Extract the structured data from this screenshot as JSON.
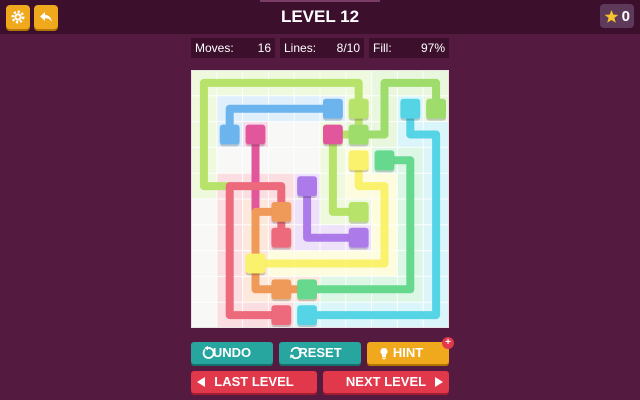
{
  "header": {
    "title": "LEVEL 12",
    "stars_count": "0"
  },
  "stats": {
    "moves_label": "Moves:",
    "moves_value": "16",
    "lines_label": "Lines:",
    "lines_value": "8/10",
    "fill_label": "Fill:",
    "fill_value": "97%"
  },
  "buttons": {
    "undo": "UNDO",
    "reset": "RESET",
    "hint": "HINT",
    "hint_badge": "+",
    "last_level": "LAST LEVEL",
    "next_level": "NEXT LEVEL"
  },
  "icons": {
    "settings": "gear-icon",
    "back": "reply-arrow-icon",
    "star": "star-icon",
    "undo": "undo-icon",
    "reset": "refresh-icon",
    "hint": "lightbulb-icon"
  },
  "board": {
    "grid_size": 10,
    "colors": {
      "lime": "#b8e36a",
      "blue": "#6cb4ee",
      "pink": "#e2579c",
      "green": "#66d98e",
      "cyan": "#55d4e6",
      "yellow": "#faf26c",
      "purple": "#ad7ae9",
      "orange": "#f09a5a",
      "red": "#ec6a7b",
      "lightgreen": "#9edc6c"
    },
    "flows": [
      {
        "color": "lime",
        "cells": [
          [
            1,
            4
          ],
          [
            0,
            4
          ],
          [
            0,
            3
          ],
          [
            0,
            2
          ],
          [
            0,
            1
          ],
          [
            0,
            0
          ],
          [
            1,
            0
          ],
          [
            2,
            0
          ],
          [
            3,
            0
          ],
          [
            4,
            0
          ],
          [
            5,
            0
          ],
          [
            6,
            0
          ],
          [
            6,
            1
          ],
          [
            6,
            2
          ],
          [
            5,
            2
          ],
          [
            5,
            3
          ],
          [
            5,
            4
          ],
          [
            5,
            5
          ],
          [
            6,
            5
          ]
        ]
      },
      {
        "color": "blue",
        "cells": [
          [
            1,
            2
          ],
          [
            1,
            1
          ],
          [
            2,
            1
          ],
          [
            3,
            1
          ],
          [
            4,
            1
          ],
          [
            5,
            1
          ]
        ]
      },
      {
        "color": "pink",
        "cells": [
          [
            2,
            2
          ],
          [
            2,
            5
          ]
        ]
      },
      {
        "color": "lightgreen",
        "cells": [
          [
            9,
            1
          ],
          [
            9,
            0
          ],
          [
            8,
            0
          ],
          [
            7,
            0
          ],
          [
            7,
            1
          ],
          [
            7,
            2
          ],
          [
            6,
            2
          ]
        ]
      },
      {
        "color": "cyan",
        "cells": [
          [
            8,
            1
          ],
          [
            8,
            2
          ],
          [
            9,
            2
          ],
          [
            9,
            3
          ],
          [
            9,
            4
          ],
          [
            9,
            5
          ],
          [
            9,
            6
          ],
          [
            9,
            7
          ],
          [
            9,
            8
          ],
          [
            9,
            9
          ],
          [
            8,
            9
          ],
          [
            7,
            9
          ],
          [
            6,
            9
          ],
          [
            5,
            9
          ],
          [
            4,
            9
          ]
        ]
      },
      {
        "color": "green",
        "cells": [
          [
            7,
            3
          ],
          [
            8,
            3
          ],
          [
            8,
            4
          ],
          [
            8,
            5
          ],
          [
            8,
            6
          ],
          [
            8,
            7
          ],
          [
            8,
            8
          ],
          [
            7,
            8
          ],
          [
            6,
            8
          ],
          [
            5,
            8
          ],
          [
            4,
            8
          ]
        ]
      },
      {
        "color": "yellow",
        "cells": [
          [
            6,
            3
          ],
          [
            6,
            4
          ],
          [
            7,
            4
          ],
          [
            7,
            5
          ],
          [
            7,
            6
          ],
          [
            7,
            7
          ],
          [
            6,
            7
          ],
          [
            5,
            7
          ],
          [
            4,
            7
          ],
          [
            3,
            7
          ],
          [
            2,
            7
          ]
        ]
      },
      {
        "color": "purple",
        "cells": [
          [
            4,
            4
          ],
          [
            4,
            5
          ],
          [
            4,
            6
          ],
          [
            5,
            6
          ],
          [
            6,
            6
          ]
        ]
      },
      {
        "color": "orange",
        "cells": [
          [
            3,
            5
          ],
          [
            2,
            5
          ],
          [
            2,
            6
          ],
          [
            2,
            7
          ],
          [
            2,
            8
          ],
          [
            3,
            8
          ],
          [
            4,
            8
          ]
        ]
      },
      {
        "color": "red",
        "cells": [
          [
            3,
            6
          ],
          [
            3,
            5
          ],
          [
            3,
            4
          ],
          [
            2,
            4
          ],
          [
            1,
            4
          ],
          [
            1,
            5
          ],
          [
            1,
            6
          ],
          [
            1,
            7
          ],
          [
            1,
            8
          ],
          [
            1,
            9
          ],
          [
            2,
            9
          ],
          [
            3,
            9
          ]
        ]
      }
    ],
    "endpoints": [
      {
        "color": "lime",
        "cell": [
          6,
          1
        ]
      },
      {
        "color": "lime",
        "cell": [
          6,
          5
        ]
      },
      {
        "color": "blue",
        "cell": [
          1,
          2
        ]
      },
      {
        "color": "blue",
        "cell": [
          5,
          1
        ]
      },
      {
        "color": "pink",
        "cell": [
          2,
          2
        ]
      },
      {
        "color": "pink",
        "cell": [
          5,
          2
        ]
      },
      {
        "color": "lightgreen",
        "cell": [
          9,
          1
        ]
      },
      {
        "color": "lightgreen",
        "cell": [
          6,
          2
        ]
      },
      {
        "color": "cyan",
        "cell": [
          8,
          1
        ]
      },
      {
        "color": "cyan",
        "cell": [
          4,
          9
        ]
      },
      {
        "color": "green",
        "cell": [
          7,
          3
        ]
      },
      {
        "color": "green",
        "cell": [
          4,
          8
        ]
      },
      {
        "color": "yellow",
        "cell": [
          6,
          3
        ]
      },
      {
        "color": "yellow",
        "cell": [
          2,
          7
        ]
      },
      {
        "color": "purple",
        "cell": [
          4,
          4
        ]
      },
      {
        "color": "purple",
        "cell": [
          6,
          6
        ]
      },
      {
        "color": "orange",
        "cell": [
          3,
          5
        ]
      },
      {
        "color": "orange",
        "cell": [
          3,
          8
        ]
      },
      {
        "color": "red",
        "cell": [
          3,
          6
        ]
      },
      {
        "color": "red",
        "cell": [
          3,
          9
        ]
      }
    ],
    "empty_cells": [
      [
        3,
        2
      ],
      [
        4,
        2
      ],
      [
        3,
        7
      ]
    ]
  }
}
